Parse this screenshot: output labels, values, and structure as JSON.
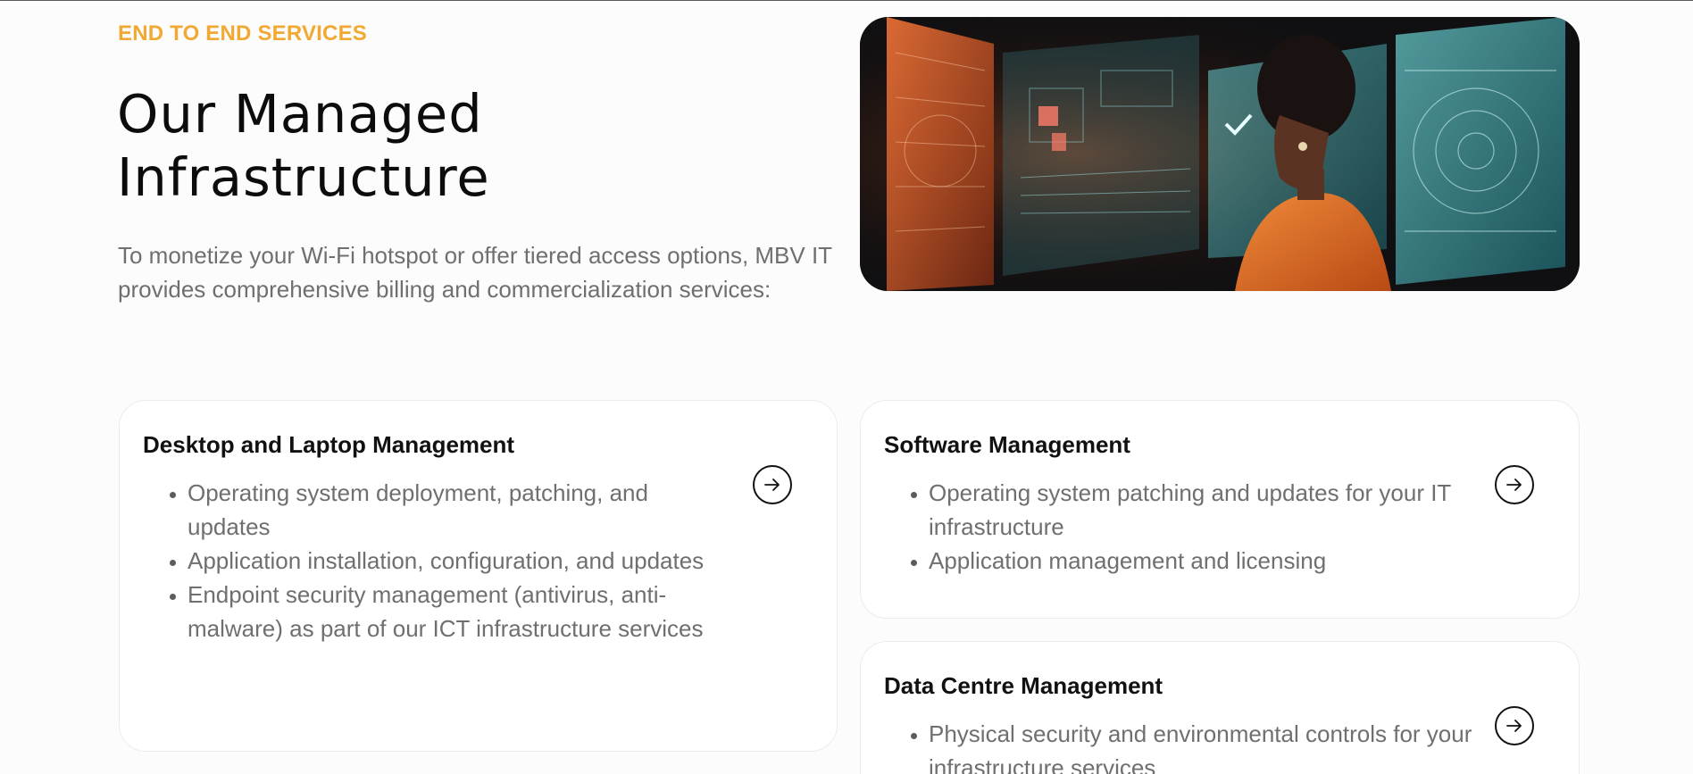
{
  "section": {
    "eyebrow": "END TO END SERVICES",
    "title": "Our Managed\nInfrastructure",
    "intro": "To monetize your Wi-Fi hotspot or offer tiered access options, MBV IT provides comprehensive billing and commercialization services:"
  },
  "colors": {
    "accent": "#f2a934",
    "heading": "#0c0c0c",
    "body_text": "#6f6f6f",
    "card_border": "#ececec"
  },
  "hero_image": {
    "alt": "Woman looking at holographic data screens"
  },
  "cards": [
    {
      "title": "Desktop and Laptop Management",
      "items": [
        "Operating system deployment, patching, and updates",
        "Application installation, configuration, and updates",
        "Endpoint security management (antivirus, anti-malware) as part of our ICT infrastructure services"
      ],
      "button_icon": "arrow-right-circle-icon"
    },
    {
      "title": "Software Management",
      "items": [
        "Operating system patching and updates for your IT infrastructure",
        "Application management and licensing"
      ],
      "button_icon": "arrow-right-circle-icon"
    },
    {
      "title": "Data Centre Management",
      "items": [
        "Physical security and environmental controls for your infrastructure services"
      ],
      "button_icon": "arrow-right-circle-icon"
    }
  ]
}
